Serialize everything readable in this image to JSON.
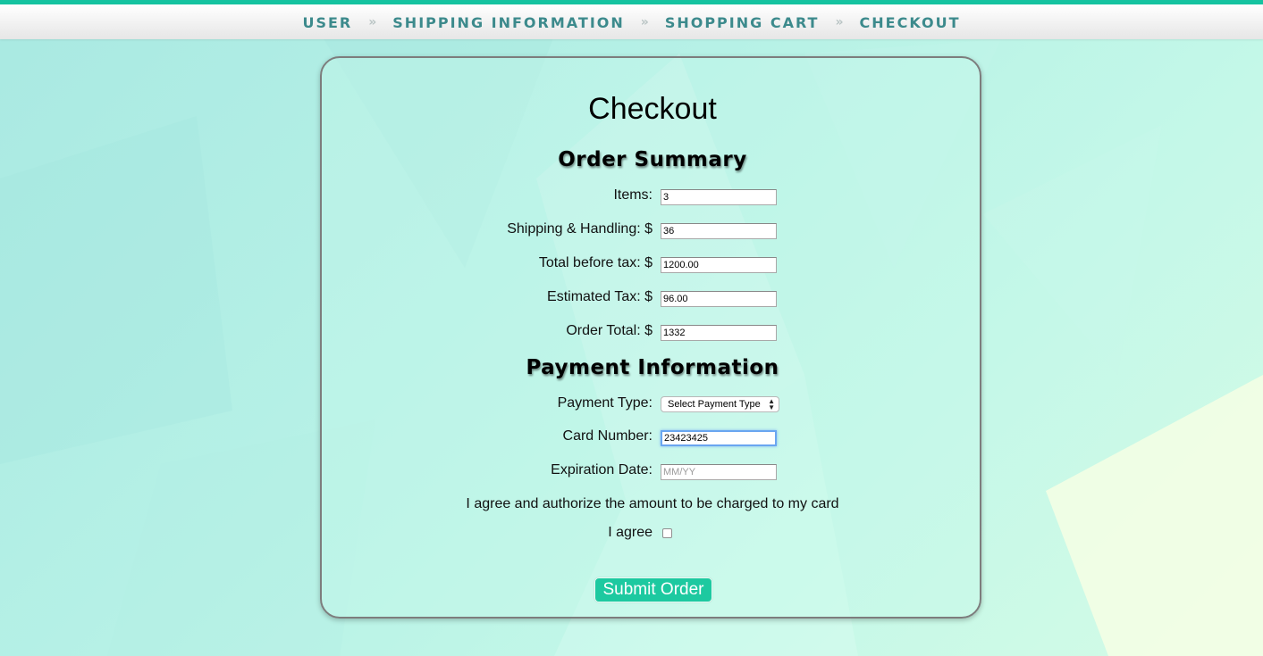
{
  "nav": {
    "steps": [
      "USER",
      "SHIPPING INFORMATION",
      "SHOPPING CART",
      "CHECKOUT"
    ],
    "separator": "»"
  },
  "page": {
    "title": "Checkout"
  },
  "order_summary": {
    "heading": "Order Summary",
    "items_label": "Items:",
    "items_value": "3",
    "shipping_label": "Shipping & Handling: $",
    "shipping_value": "36",
    "subtotal_label": "Total before tax: $",
    "subtotal_value": "1200.00",
    "tax_label": "Estimated Tax: $",
    "tax_value": "96.00",
    "total_label": "Order Total: $",
    "total_value": "1332"
  },
  "payment": {
    "heading": "Payment Information",
    "type_label": "Payment Type:",
    "type_selected": "Select Payment Type",
    "card_label": "Card Number:",
    "card_value": "23423425",
    "exp_label": "Expiration Date:",
    "exp_placeholder": "MM/YY",
    "authorize_text": "I agree and authorize the amount to be charged to my card",
    "agree_label": "I agree",
    "agree_checked": false
  },
  "submit_label": "Submit Order",
  "colors": {
    "accent": "#15c3a0",
    "nav_text": "#3c8a8c",
    "button": "#1dc9a0",
    "background": "#b6f1e6"
  }
}
